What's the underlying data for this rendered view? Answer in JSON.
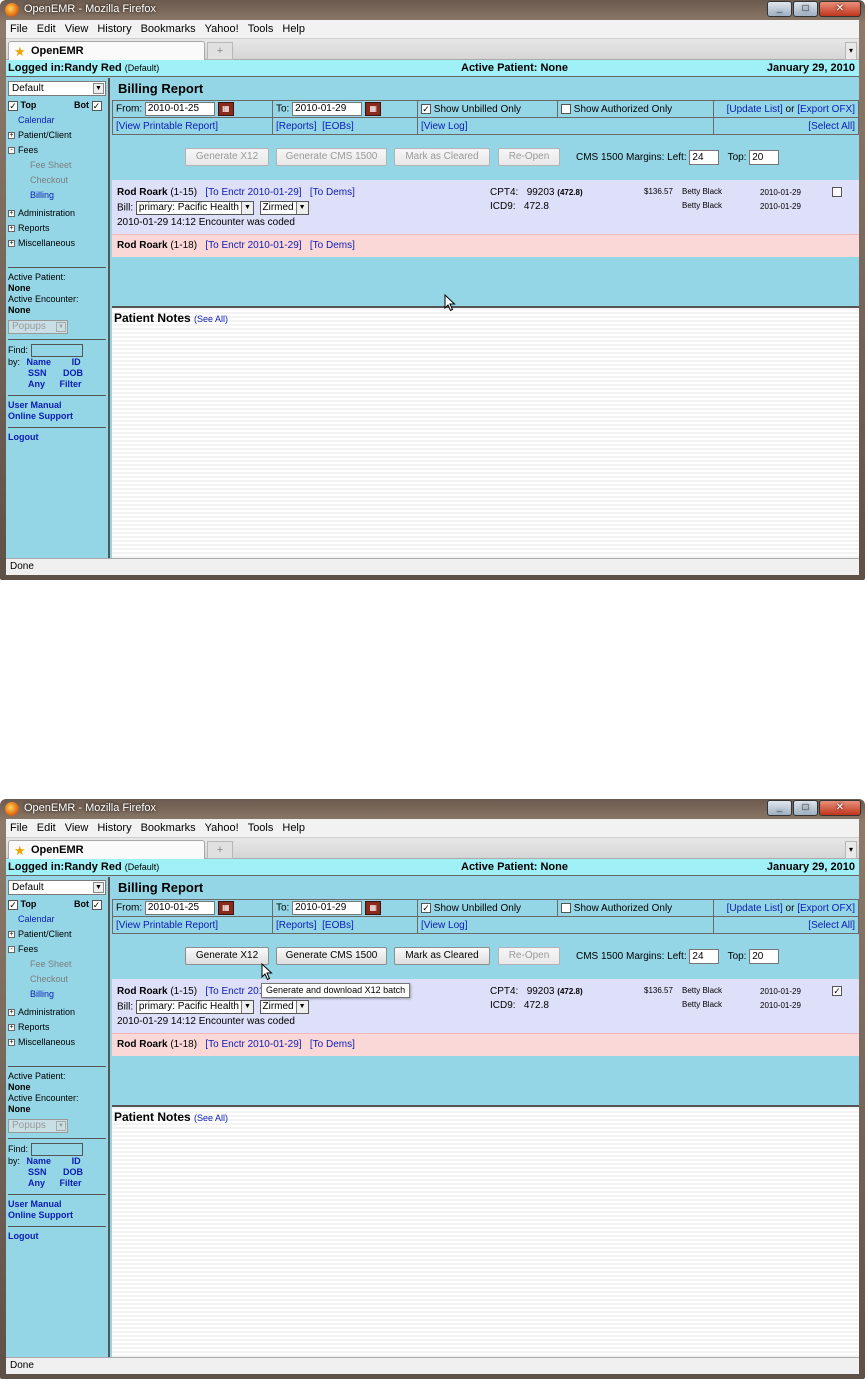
{
  "window": {
    "title": "OpenEMR - Mozilla Firefox",
    "buttons": {
      "min": "_",
      "max": "□",
      "close": "✕"
    }
  },
  "menu": [
    "File",
    "Edit",
    "View",
    "History",
    "Bookmarks",
    "Yahoo!",
    "Tools",
    "Help"
  ],
  "tab": {
    "label": "OpenEMR",
    "new_tab": "+"
  },
  "header": {
    "logged_in": "Logged in:Randy Red",
    "logged_in_sub": "(Default)",
    "active_patient": "Active Patient: None",
    "date": "January 29, 2010"
  },
  "nav": {
    "select": "Default",
    "top": "Top",
    "bot": "Bot",
    "calendar": "Calendar",
    "patient_client": "Patient/Client",
    "fees": "Fees",
    "fee_sheet": "Fee Sheet",
    "checkout": "Checkout",
    "billing": "Billing",
    "administration": "Administration",
    "reports": "Reports",
    "miscellaneous": "Miscellaneous",
    "active_patient_label": "Active Patient:",
    "active_patient_value": "None",
    "active_encounter_label": "Active Encounter:",
    "active_encounter_value": "None",
    "popups": "Popups",
    "find": "Find:",
    "by": "by:",
    "name": "Name",
    "id": "ID",
    "ssn": "SSN",
    "dob": "DOB",
    "any": "Any",
    "filter": "Filter",
    "user_manual": "User Manual",
    "online_support": "Online Support",
    "logout": "Logout"
  },
  "billing": {
    "title": "Billing Report",
    "from_label": "From:",
    "from_value": "2010-01-25",
    "to_label": "To:",
    "to_value": "2010-01-29",
    "show_unbilled": "Show Unbilled Only",
    "show_authorized": "Show Authorized Only",
    "update_list": "[Update List]",
    "or": "or",
    "export_ofx": "[Export OFX]",
    "view_printable": "[View Printable Report]",
    "reports": "[Reports]",
    "eobs": "[EOBs]",
    "view_log": "[View Log]",
    "select_all": "[Select All]",
    "buttons": {
      "gen_x12": "Generate X12",
      "gen_cms": "Generate CMS 1500",
      "mark_cleared": "Mark as Cleared",
      "reopen": "Re-Open"
    },
    "margins_label": "CMS 1500 Margins:",
    "left_label": "Left:",
    "left_value": "24",
    "top_label": "Top:",
    "top_value": "20"
  },
  "rows": {
    "r1": {
      "name": "Rod Roark",
      "pid": "(1-15)",
      "enctr": "[To Enctr 2010-01-29]",
      "dems": "[To Dems]",
      "bill_label": "Bill:",
      "bill_value": "primary: Pacific Health",
      "clearing": "Zirmed",
      "coded": "2010-01-29 14:12 Encounter was coded",
      "cpt_label": "CPT4:",
      "cpt_value": "99203",
      "cpt_dx": "(472.8)",
      "icd_label": "ICD9:",
      "icd_value": "472.8",
      "fee": "$136.57",
      "provider1": "Betty Black",
      "provider2": "Betty Black",
      "date1": "2010-01-29",
      "date2": "2010-01-29"
    },
    "r2": {
      "name": "Rod Roark",
      "pid": "(1-18)",
      "enctr": "[To Enctr 2010-01-29]",
      "dems": "[To Dems]"
    }
  },
  "notes": {
    "title": "Patient Notes",
    "see_all": "(See All)"
  },
  "status": "Done",
  "tooltip": "Generate and download X12 batch",
  "check_mark": "✓"
}
